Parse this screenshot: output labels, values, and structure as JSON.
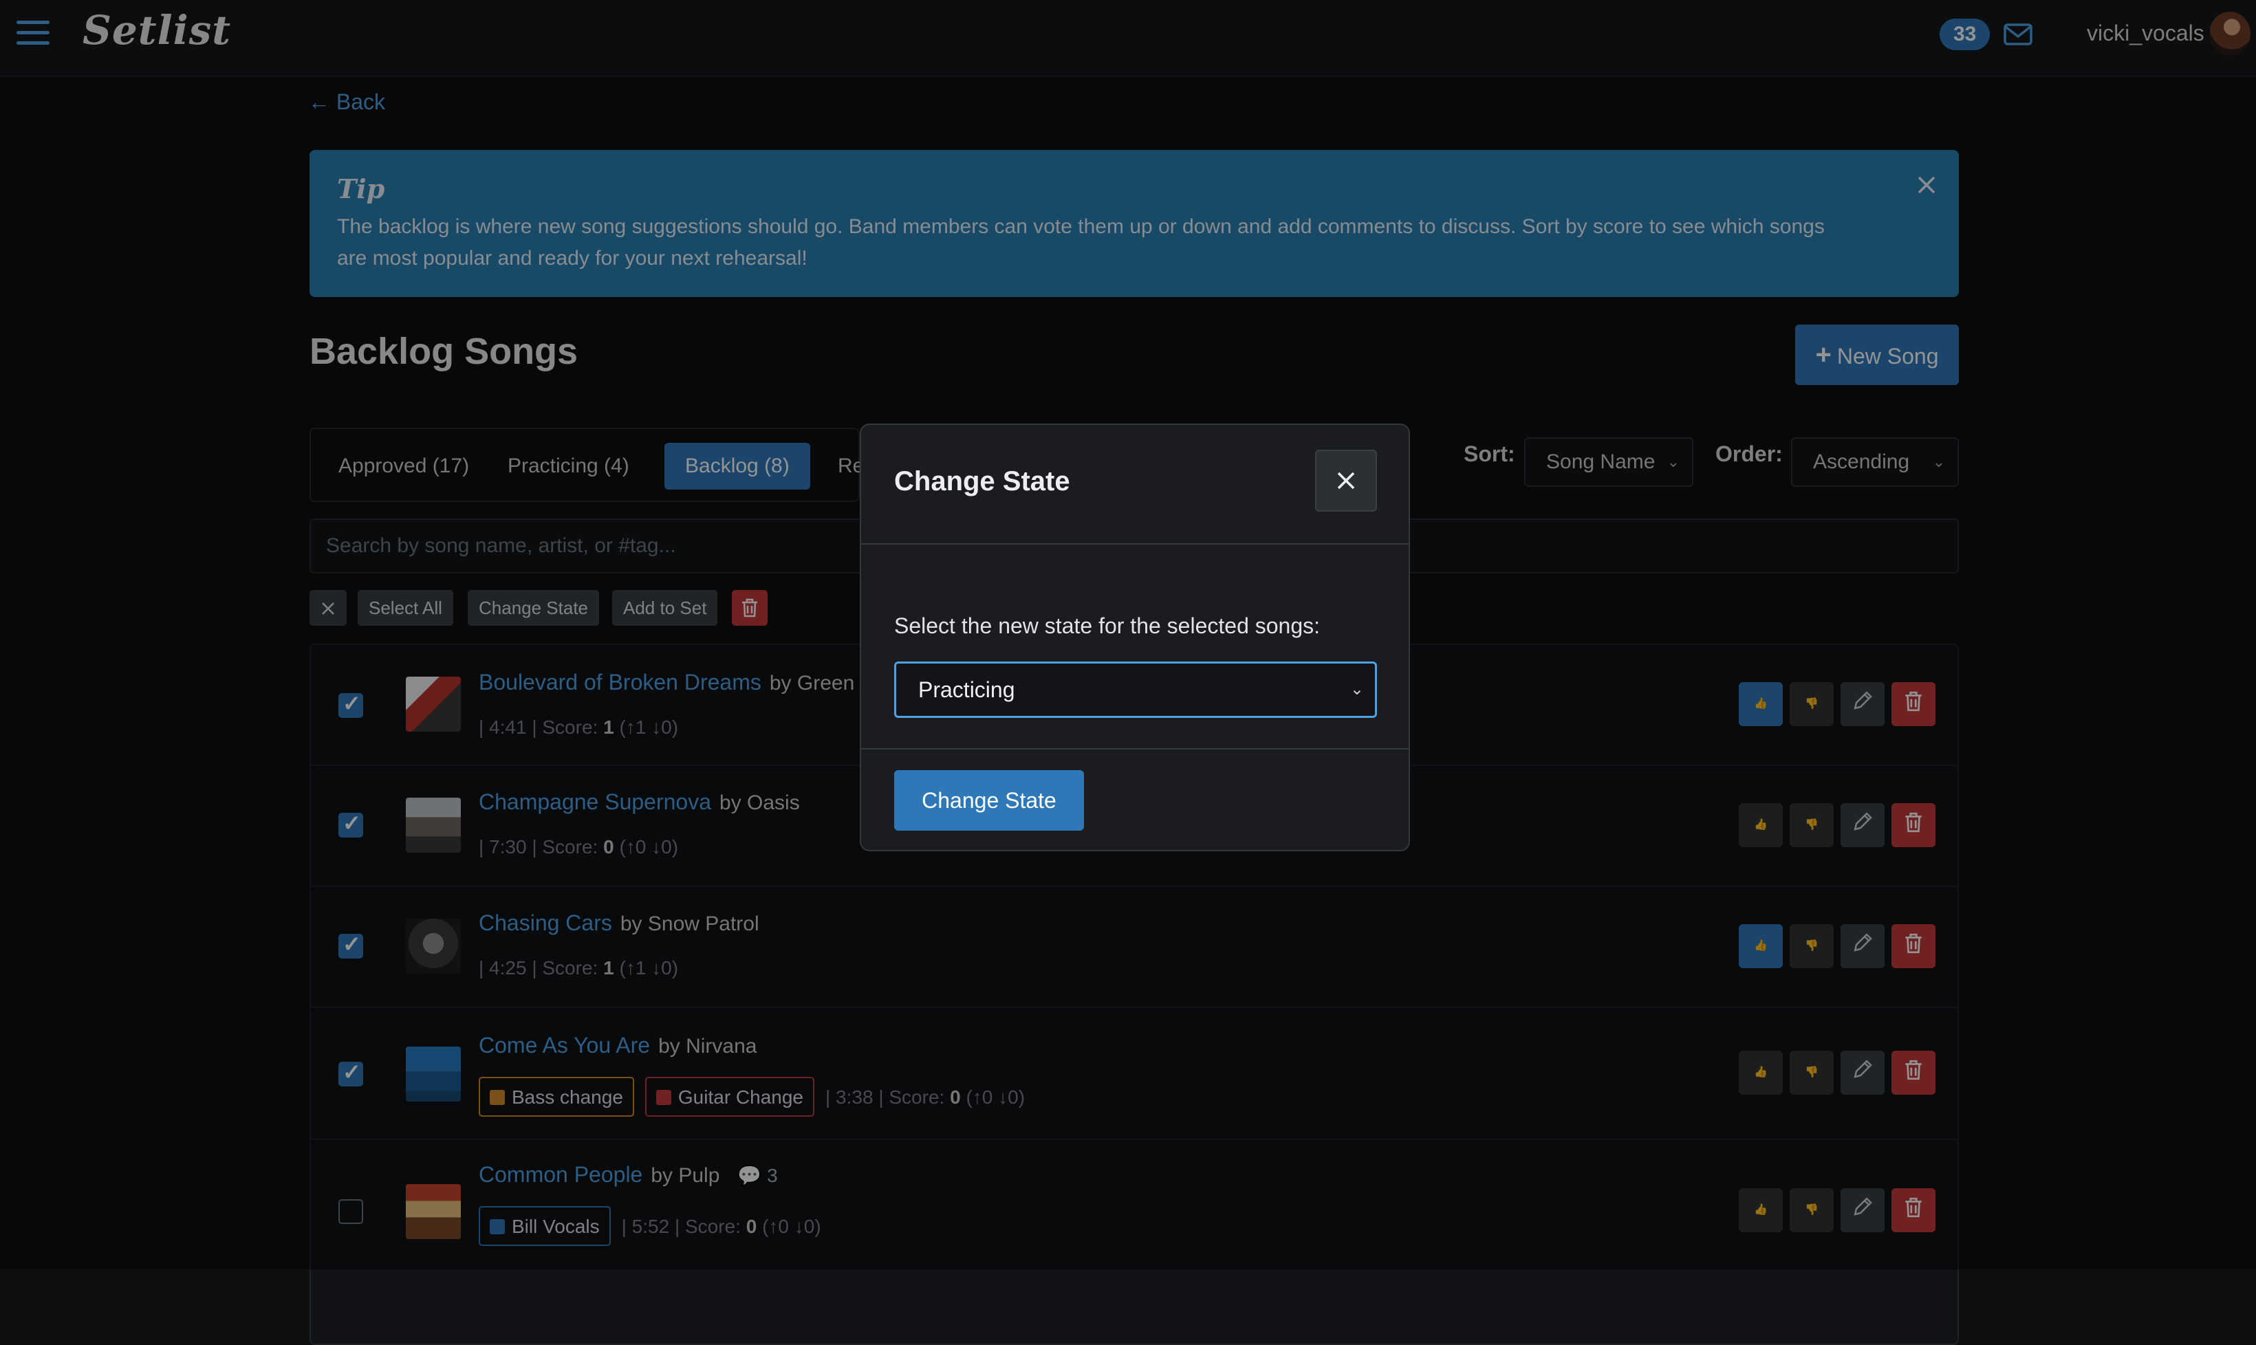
{
  "app": {
    "brand": "Setlist",
    "notification_count": "33",
    "username": "vicki_vocals"
  },
  "nav": {
    "back_label": "← Back"
  },
  "tip": {
    "title": "Tip",
    "text": "The backlog is where new song suggestions should go. Band members can vote them up or down and add comments to discuss. Sort by score to see which songs are most popular and ready for your next rehearsal!"
  },
  "page": {
    "title": "Backlog Songs",
    "new_song_label": "New Song"
  },
  "tabs": [
    "Approved (17)",
    "Practicing (4)",
    "Backlog (8)",
    "Re"
  ],
  "sort": {
    "label": "Sort:",
    "value": "Song Name",
    "order_label": "Order:",
    "order_value": "Ascending"
  },
  "search": {
    "placeholder": "Search by song name, artist, or #tag..."
  },
  "bulk": {
    "select_all": "Select All",
    "change_state": "Change State",
    "add_to_set": "Add to Set"
  },
  "songs": [
    {
      "title": "Boulevard of Broken Dreams",
      "artist": "by Green",
      "meta_pre": "| 4:41 | Score: ",
      "score": "1",
      "votes": "(↑1 ↓0)",
      "checked": true,
      "upvoted": true
    },
    {
      "title": "Champagne Supernova",
      "artist": "by Oasis",
      "meta_pre": "| 7:30 | Score: ",
      "score": "0",
      "votes": "(↑0 ↓0)",
      "checked": true,
      "upvoted": false
    },
    {
      "title": "Chasing Cars",
      "artist": "by Snow Patrol",
      "meta_pre": "| 4:25 | Score: ",
      "score": "1",
      "votes": "(↑1 ↓0)",
      "checked": true,
      "upvoted": true
    },
    {
      "title": "Come As You Are",
      "artist": "by Nirvana",
      "tags": [
        {
          "label": "Bass change",
          "color": "#d08a2c"
        },
        {
          "label": "Guitar Change",
          "color": "#c33a3a"
        }
      ],
      "meta_pre": "| 3:38 | Score: ",
      "score": "0",
      "votes": "(↑0 ↓0)",
      "checked": true,
      "upvoted": false
    },
    {
      "title": "Common People",
      "artist": "by Pulp",
      "comments": "3",
      "tags": [
        {
          "label": "Bill Vocals",
          "color": "#2f78b8"
        }
      ],
      "meta_pre": "| 5:52 | Score: ",
      "score": "0",
      "votes": "(↑0 ↓0)",
      "checked": false,
      "upvoted": false
    }
  ],
  "modal": {
    "title": "Change State",
    "prompt": "Select the new state for the selected songs:",
    "selected_state": "Practicing",
    "submit_label": "Change State"
  }
}
